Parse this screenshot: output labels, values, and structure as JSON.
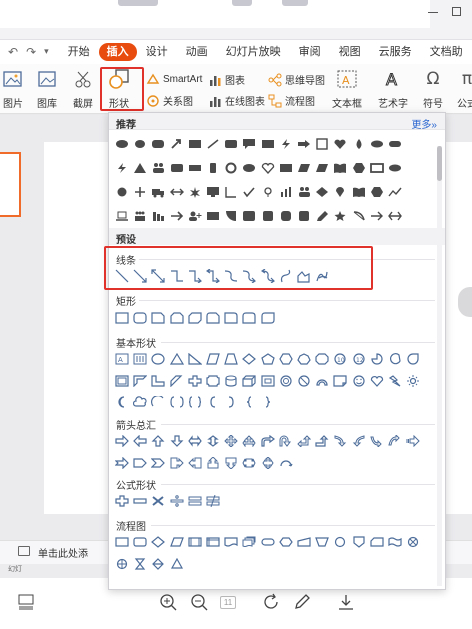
{
  "menu": {
    "tabs": [
      "开始",
      "插入",
      "设计",
      "动画",
      "幻灯片放映",
      "审阅",
      "视图",
      "云服务",
      "文档助"
    ],
    "active": "插入"
  },
  "ribbon": {
    "picture": "图片",
    "gallery": "图库",
    "screenshot": "截屏",
    "shapes": "形状",
    "smartart": "SmartArt",
    "relation": "关系图",
    "chart": "图表",
    "online_chart": "在线图表",
    "mindmap": "思维导图",
    "flowchart": "流程图",
    "textbox": "文本框",
    "wordart": "艺术字",
    "symbol": "符号",
    "formula": "公式"
  },
  "panel": {
    "recommended": "推荐",
    "more": "更多»",
    "presets": "预设",
    "lines": "线条",
    "rectangles": "矩形",
    "basic_shapes": "基本形状",
    "arrows": "箭头总汇",
    "formula_shapes": "公式形状",
    "flowchart": "流程图"
  },
  "note_placeholder": "单击此处添",
  "page_indicator": "11",
  "colors": {
    "accent": "#e84c0e",
    "highlight": "#e0312a",
    "shape_stroke": "#4d6d9a",
    "shape_fill": "#4a4a4a"
  }
}
